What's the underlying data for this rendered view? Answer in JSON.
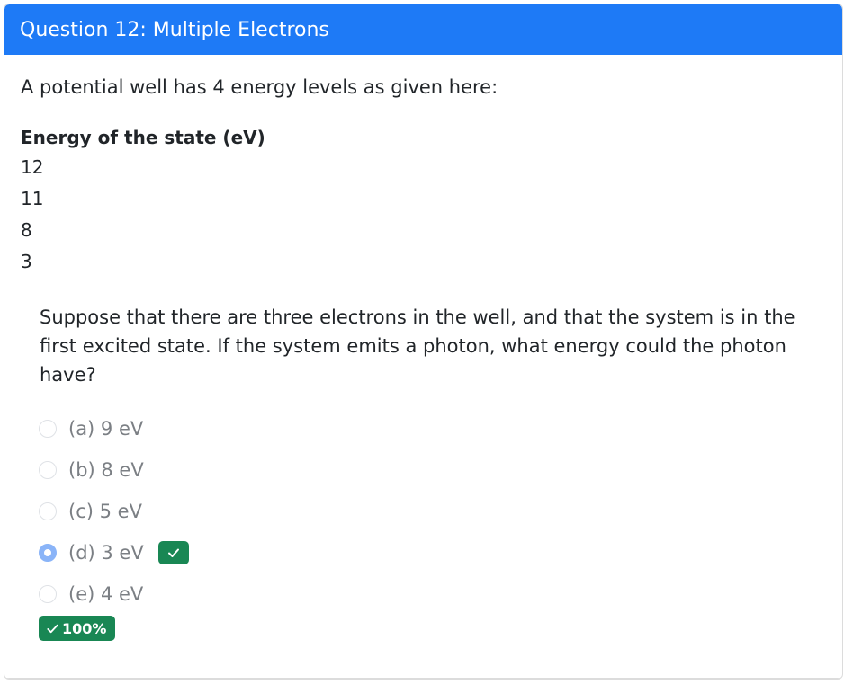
{
  "card": {
    "title": "Question 12: Multiple Electrons"
  },
  "problem": {
    "intro": "A potential well has 4 energy levels as given here:",
    "table_header": "Energy of the state (eV)",
    "energies": [
      "12",
      "11",
      "8",
      "3"
    ],
    "question": "Suppose that there are three electrons in the well, and that the system is in the first excited state. If the system emits a photon, what energy could the photon have?"
  },
  "options": [
    {
      "label": "(a) 9 eV",
      "selected": false
    },
    {
      "label": "(b) 8 eV",
      "selected": false
    },
    {
      "label": "(c) 5 eV",
      "selected": false
    },
    {
      "label": "(d) 3 eV",
      "selected": true,
      "correct": true
    },
    {
      "label": "(e) 4 eV",
      "selected": false
    }
  ],
  "score": {
    "label": "100%"
  },
  "colors": {
    "header_bg": "#1e7af6",
    "success": "#198754",
    "selected_radio": "#8ab4f8"
  },
  "icons": {
    "correct": "check-icon"
  }
}
